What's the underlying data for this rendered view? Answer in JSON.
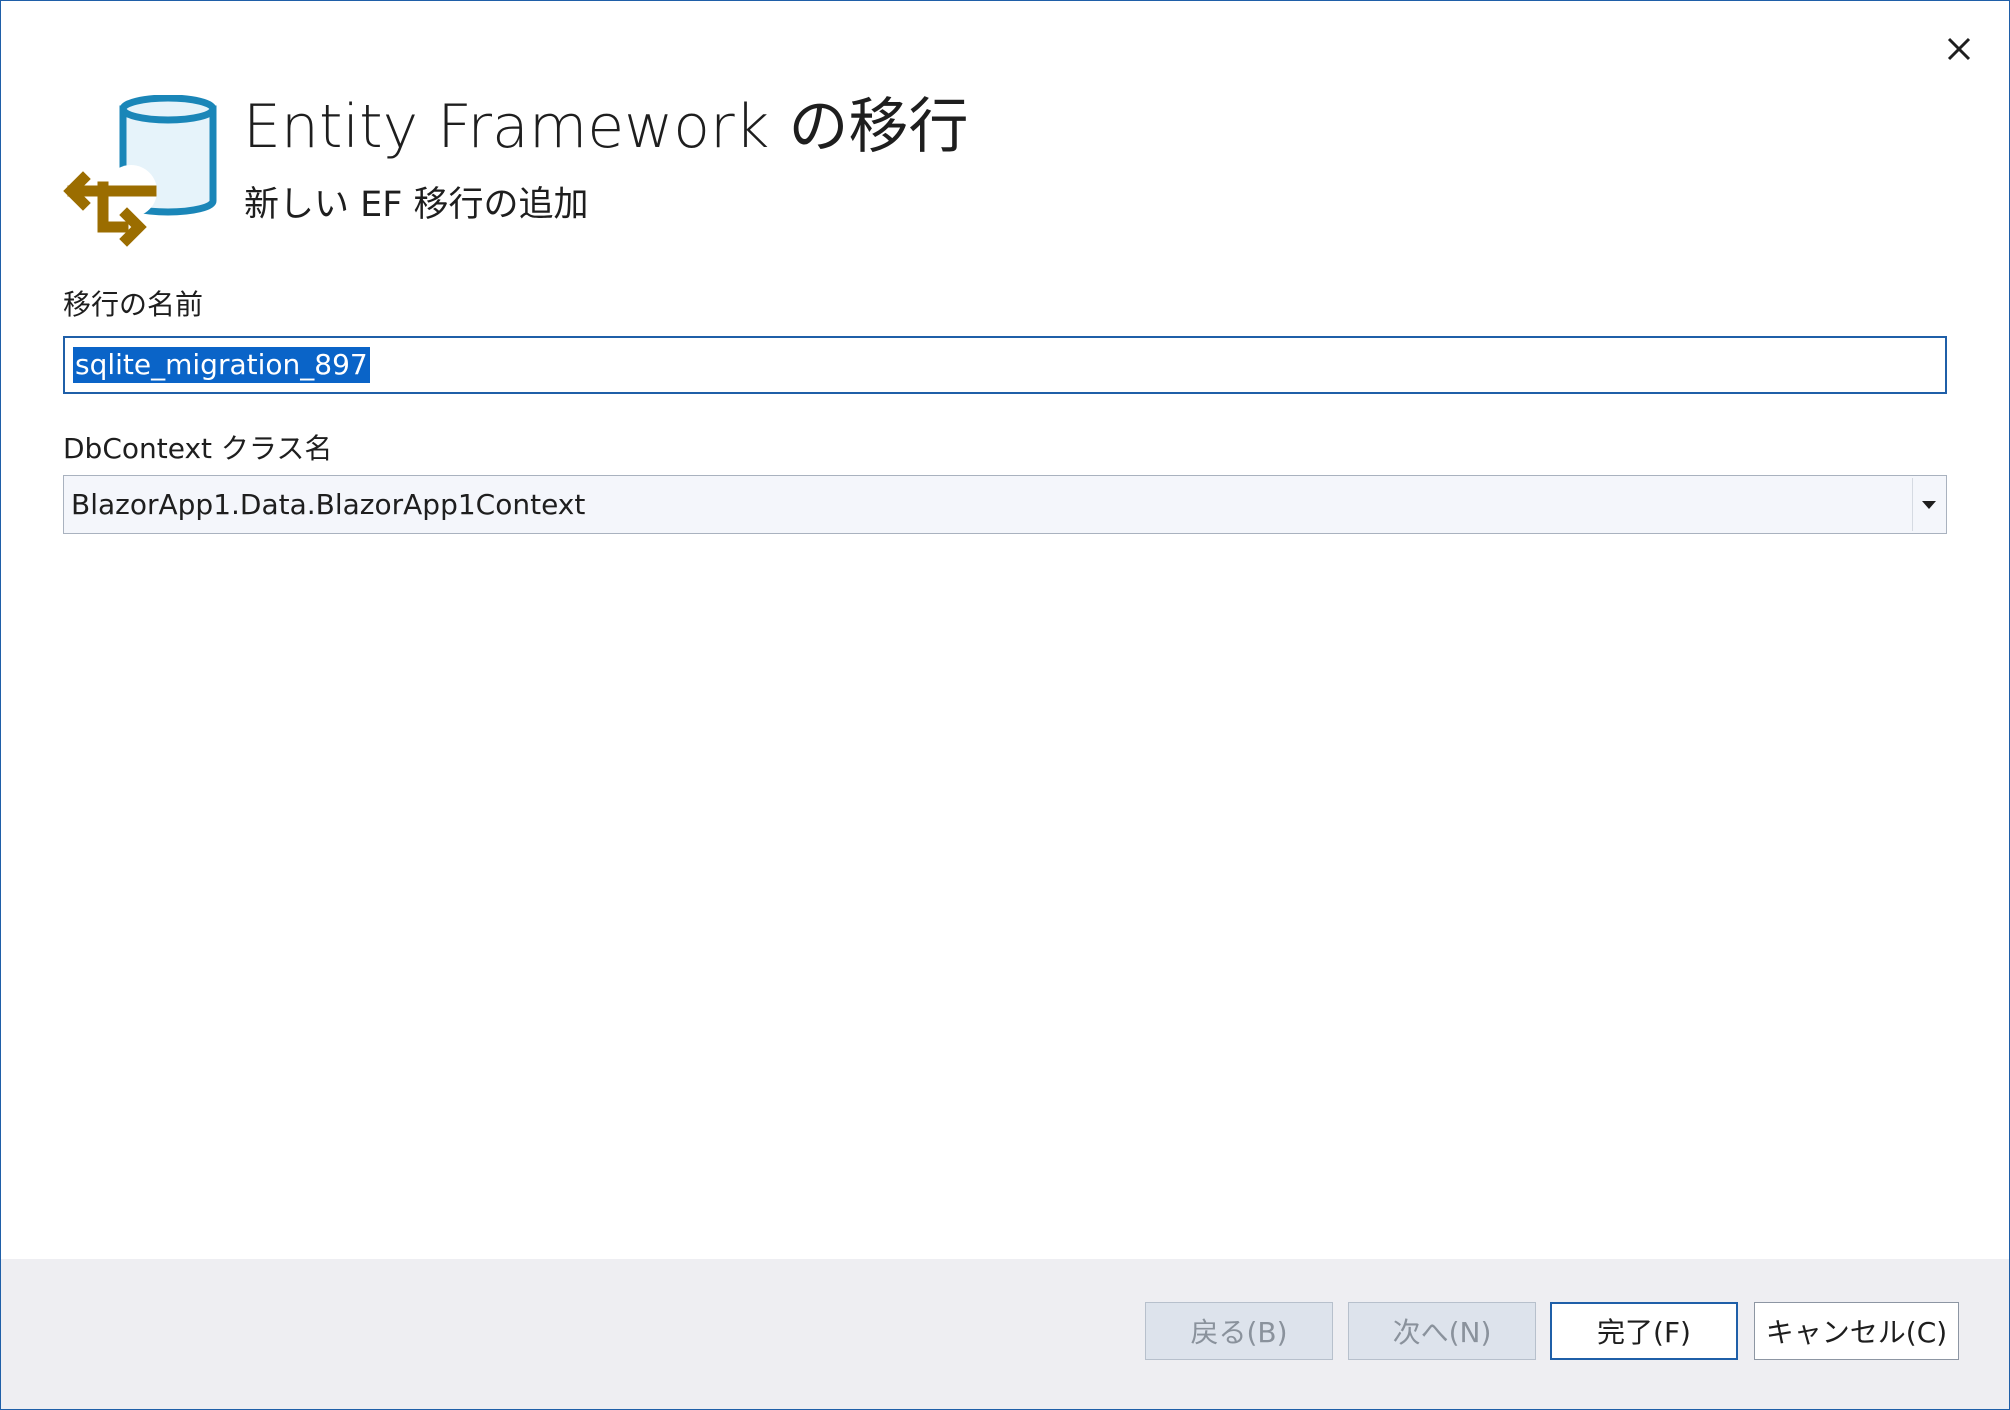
{
  "header": {
    "title": "Entity Framework の移行",
    "subtitle": "新しい EF 移行の追加"
  },
  "form": {
    "migration_name_label": "移行の名前",
    "migration_name_value": "sqlite_migration_897",
    "dbcontext_label": "DbContext クラス名",
    "dbcontext_value": "BlazorApp1.Data.BlazorApp1Context"
  },
  "footer": {
    "back_label": "戻る(B)",
    "next_label": "次へ(N)",
    "finish_label": "完了(F)",
    "cancel_label": "キャンセル(C)"
  },
  "icons": {
    "close": "close-icon",
    "logo": "ef-migration-logo-icon",
    "dropdown": "chevron-down-icon"
  },
  "colors": {
    "accent": "#1f5fa8",
    "selection": "#0a64c8",
    "database_blue": "#1a86b8",
    "migration_gold": "#9b6d00"
  }
}
